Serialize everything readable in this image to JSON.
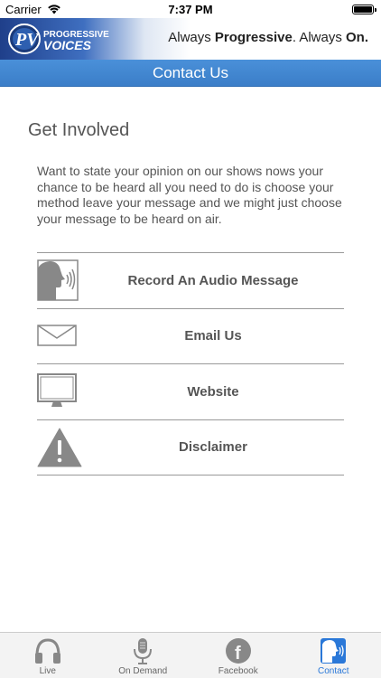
{
  "status_bar": {
    "carrier": "Carrier",
    "time": "7:37 PM"
  },
  "banner": {
    "logo_text_top": "PROGRESSIVE",
    "logo_text_bottom": "VOICES",
    "tagline_part1": "Always ",
    "tagline_part2": "Progressive",
    "tagline_part3": ". Always ",
    "tagline_part4": "On."
  },
  "header": {
    "title": "Contact Us"
  },
  "main": {
    "heading": "Get Involved",
    "intro": "Want to state your opinion on our shows nows your chance to be heard all you need to do is choose your method leave your message and we might just choose your message to be heard on air.",
    "items": [
      {
        "label": "Record An Audio Message",
        "icon": "speaking-head-icon"
      },
      {
        "label": "Email Us",
        "icon": "envelope-icon"
      },
      {
        "label": "Website",
        "icon": "monitor-icon"
      },
      {
        "label": "Disclaimer",
        "icon": "warning-icon"
      }
    ]
  },
  "tabs": [
    {
      "label": "Live",
      "icon": "headphones-icon",
      "active": false
    },
    {
      "label": "On Demand",
      "icon": "microphone-icon",
      "active": false
    },
    {
      "label": "Facebook",
      "icon": "facebook-icon",
      "active": false
    },
    {
      "label": "Contact",
      "icon": "speaking-head-icon",
      "active": true
    }
  ],
  "colors": {
    "accent": "#2a78d8",
    "title_bar": "#4a90d9",
    "text": "#555555",
    "icon_gray": "#888888"
  }
}
